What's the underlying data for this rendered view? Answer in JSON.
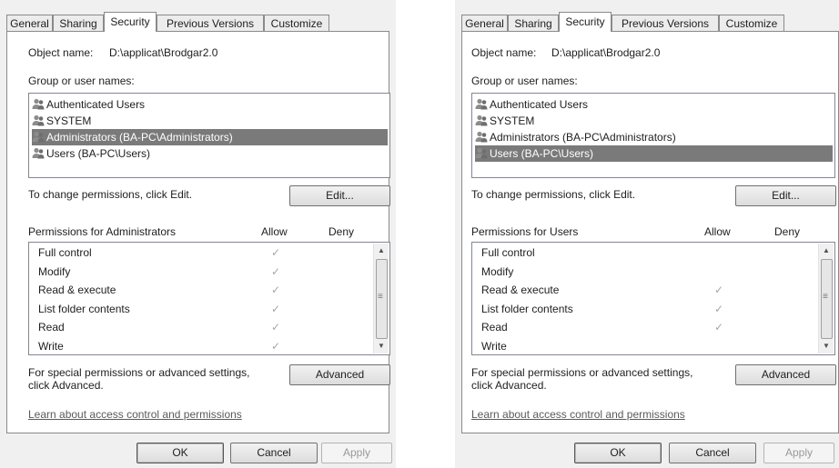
{
  "tabs": [
    "General",
    "Sharing",
    "Security",
    "Previous Versions",
    "Customize"
  ],
  "object_name_label": "Object name:",
  "object_name_value": "D:\\applicat\\Brodgar2.0",
  "group_label": "Group or user names:",
  "users": [
    "Authenticated Users",
    "SYSTEM",
    "Administrators (BA-PC\\Administrators)",
    "Users (BA-PC\\Users)"
  ],
  "change_text": "To change permissions, click Edit.",
  "edit_button": "Edit...",
  "allow_header": "Allow",
  "deny_header": "Deny",
  "permissions": [
    "Full control",
    "Modify",
    "Read & execute",
    "List folder contents",
    "Read",
    "Write"
  ],
  "check_glyph": "✓",
  "special_text_1": "For special permissions or advanced settings,",
  "special_text_2": "click Advanced.",
  "advanced_button": "Advanced",
  "learn_link": "Learn about access control and permissions",
  "ok_button": "OK",
  "cancel_button": "Cancel",
  "apply_button": "Apply",
  "left": {
    "perm_for": "Permissions for Administrators",
    "selected_user_index": 2,
    "allow_checked": [
      true,
      true,
      true,
      true,
      true,
      true
    ]
  },
  "right": {
    "perm_for": "Permissions for Users",
    "selected_user_index": 3,
    "allow_checked": [
      false,
      false,
      true,
      true,
      true,
      false
    ]
  },
  "colors": {
    "selection": "#7a7a7a",
    "check": "#a6a6a6",
    "panel_border": "#8a8a8a"
  }
}
